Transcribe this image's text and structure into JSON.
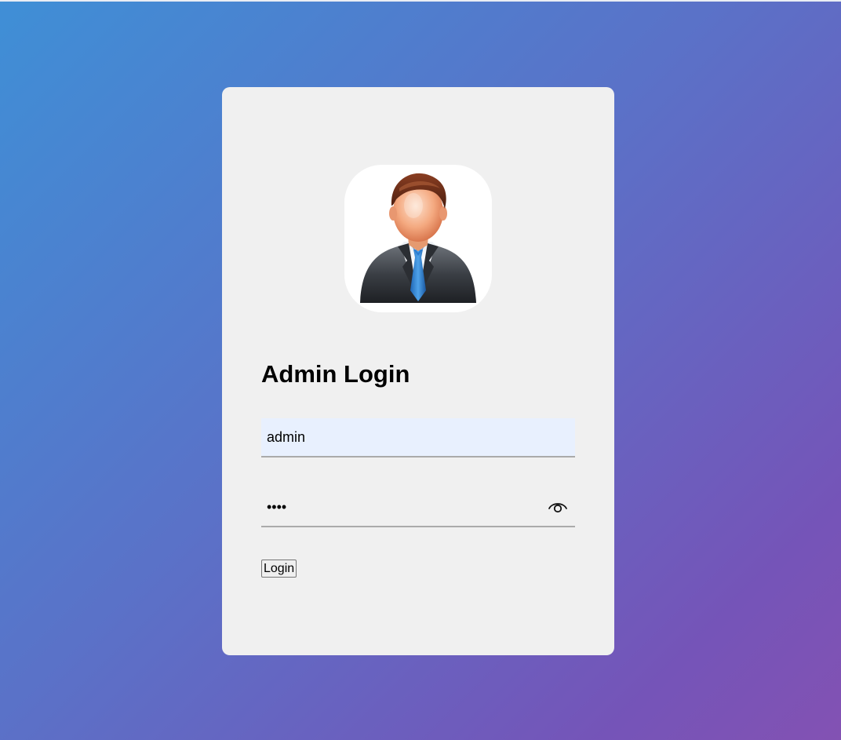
{
  "login": {
    "title": "Admin Login",
    "username_value": "admin",
    "password_value": "••••",
    "login_button": "Login",
    "avatar_icon": "admin-avatar-icon",
    "toggle_icon": "eye-icon"
  },
  "colors": {
    "gradient_start": "#3f8fd6",
    "gradient_end": "#8352b3",
    "card_bg": "#f0f0f0",
    "autofill_bg": "#e8f0fe"
  }
}
